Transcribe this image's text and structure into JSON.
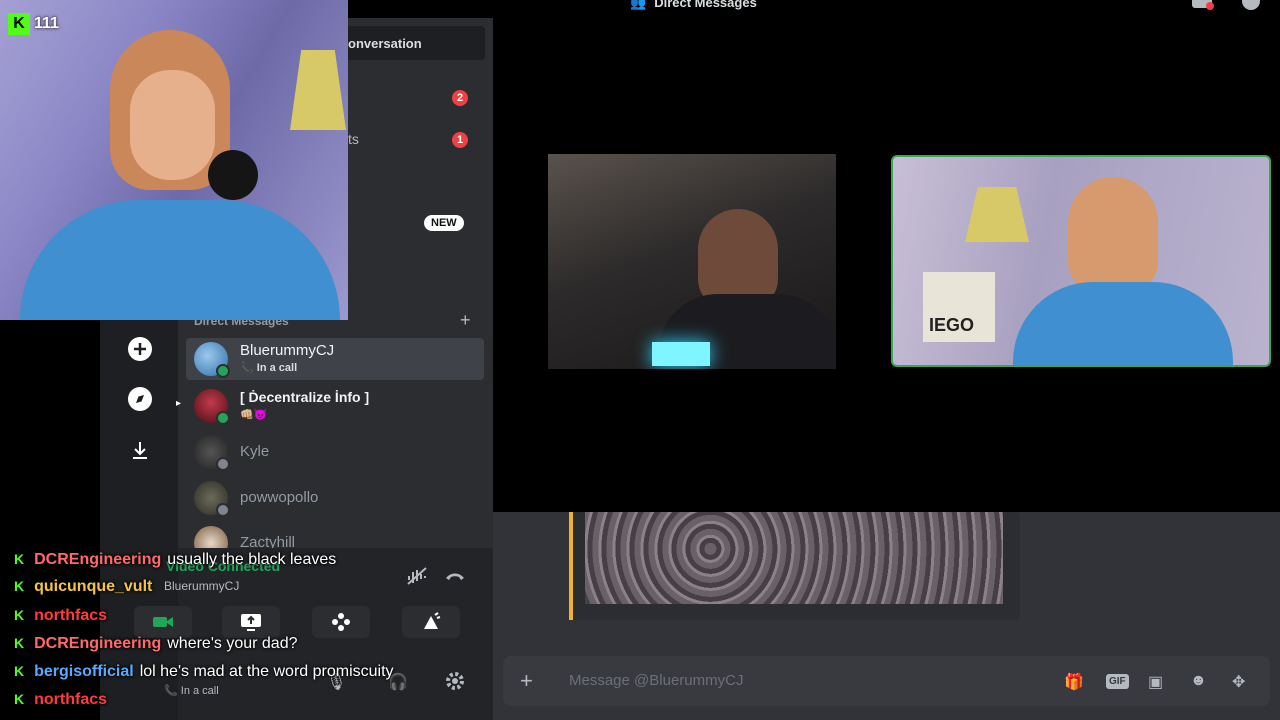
{
  "top_bar": {
    "title": "Direct Messages"
  },
  "stream": {
    "viewer_count": "111",
    "logo_letter": "K"
  },
  "sidebar": {
    "find_conversation": "onversation",
    "badge_one": "2",
    "badge_two": "1",
    "partial_item": "ts",
    "new_badge": "NEW",
    "dm_header": "Direct Messages",
    "dm_add": "+",
    "dms": [
      {
        "name": "BluerummyCJ",
        "status": "In a call"
      },
      {
        "name": "[ Ḋecentralize İnfo ]",
        "status": "👊🏼😈"
      },
      {
        "name": "Kyle",
        "status": ""
      },
      {
        "name": "powwopollo",
        "status": ""
      },
      {
        "name": "Zactyhill",
        "status": ""
      }
    ]
  },
  "voice_panel": {
    "status": "Video Connected",
    "channel": "BluerummyCJ",
    "user_status": "In a call"
  },
  "chat": {
    "placeholder": "Message @BluerummyCJ",
    "add": "+",
    "gif": "GIF"
  },
  "stream_chat": [
    {
      "user": "DCREngineering",
      "color": "#ff6a6a",
      "message": "usually the black leaves"
    },
    {
      "user": "quicunque_vult",
      "color": "#f5c542",
      "message": ""
    },
    {
      "user": "northfacs",
      "color": "#ff3b3b",
      "message": ""
    },
    {
      "user": "DCREngineering",
      "color": "#ff6a6a",
      "message": "where's your dad?"
    },
    {
      "user": "bergisofficial",
      "color": "#5aa9ff",
      "message": "lol he's mad at the word promiscuity"
    },
    {
      "user": "northfacs",
      "color": "#ff3b3b",
      "message": ""
    }
  ]
}
